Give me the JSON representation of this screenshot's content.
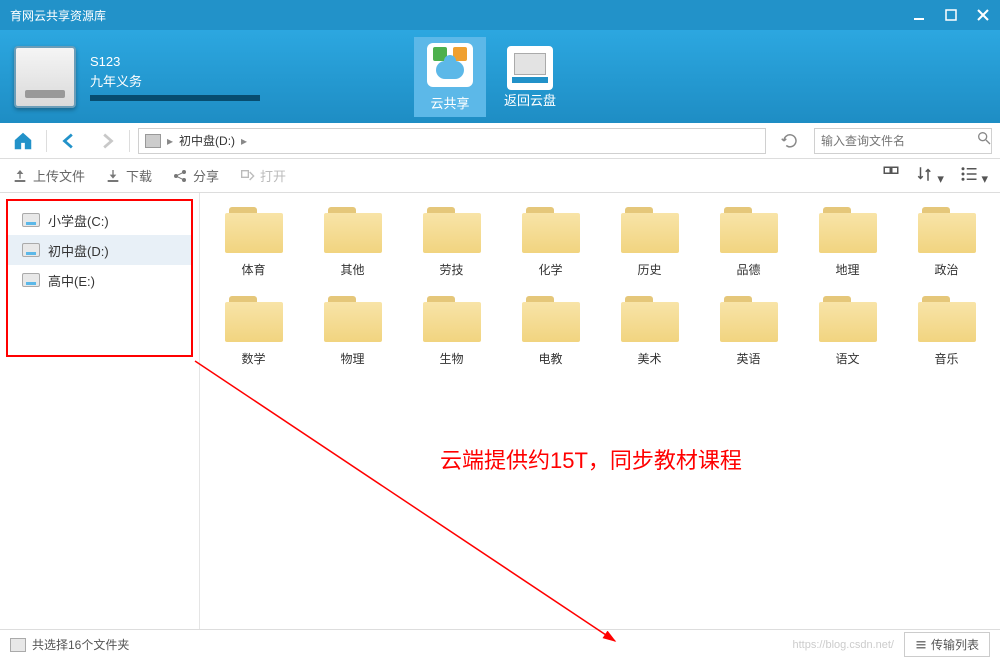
{
  "titlebar": {
    "title": "育网云共享资源库"
  },
  "user": {
    "code": "S123",
    "grade": "九年义务"
  },
  "headerTabs": {
    "cloud": "云共享",
    "return": "返回云盘"
  },
  "nav": {
    "breadcrumb_drive": "初中盘(D:)",
    "sep": "▸"
  },
  "search": {
    "placeholder": "输入查询文件名"
  },
  "toolbar": {
    "upload": "上传文件",
    "download": "下载",
    "share": "分享",
    "open": "打开"
  },
  "drives": [
    {
      "label": "小学盘(C:)"
    },
    {
      "label": "初中盘(D:)"
    },
    {
      "label": "高中(E:)"
    }
  ],
  "folders": [
    {
      "name": "体育"
    },
    {
      "name": "其他"
    },
    {
      "name": "劳技"
    },
    {
      "name": "化学"
    },
    {
      "name": "历史"
    },
    {
      "name": "品德"
    },
    {
      "name": "地理"
    },
    {
      "name": "政治"
    },
    {
      "name": "数学"
    },
    {
      "name": "物理"
    },
    {
      "name": "生物"
    },
    {
      "name": "电教"
    },
    {
      "name": "美术"
    },
    {
      "name": "英语"
    },
    {
      "name": "语文"
    },
    {
      "name": "音乐"
    }
  ],
  "annotation": "云端提供约15T，同步教材课程",
  "status": {
    "selection": "共选择16个文件夹",
    "transfer": "传输列表"
  },
  "watermark": "https://blog.csdn.net/"
}
